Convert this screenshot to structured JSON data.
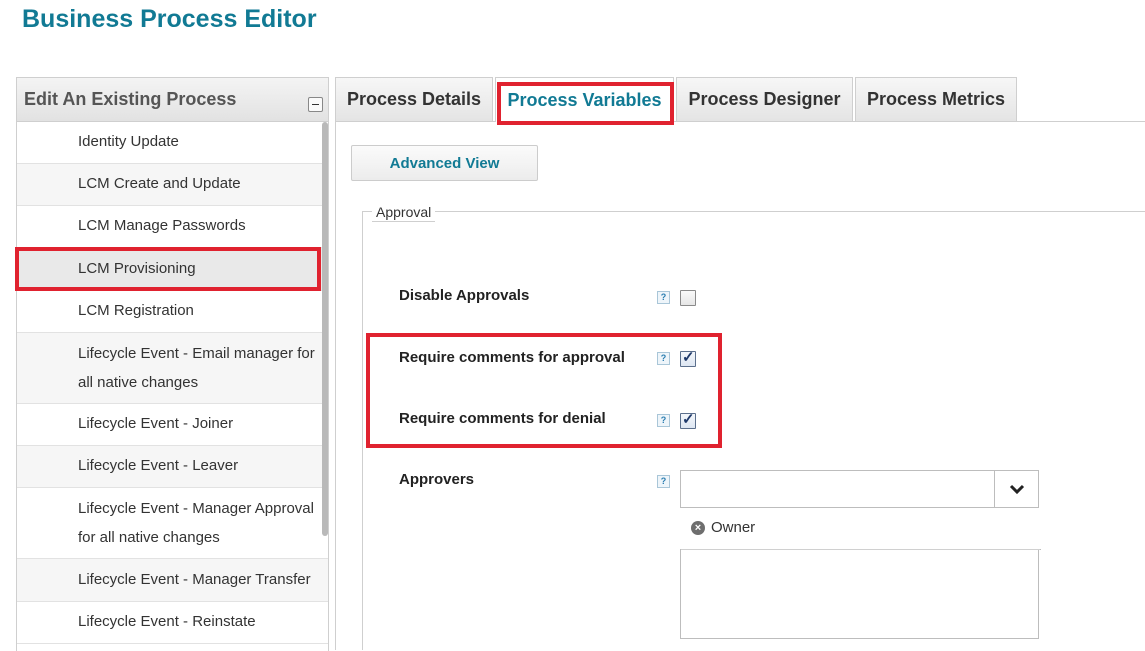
{
  "app": {
    "title": "Business Process Editor"
  },
  "sidebar": {
    "title": "Edit An Existing Process",
    "items": [
      {
        "label": "Identity Update"
      },
      {
        "label": "LCM Create and Update"
      },
      {
        "label": "LCM Manage Passwords"
      },
      {
        "label": "LCM Provisioning",
        "selected": true
      },
      {
        "label": "LCM Registration"
      },
      {
        "label": "Lifecycle Event - Email manager for all native changes"
      },
      {
        "label": "Lifecycle Event - Joiner"
      },
      {
        "label": "Lifecycle Event - Leaver"
      },
      {
        "label": "Lifecycle Event - Manager Approval for all native changes"
      },
      {
        "label": "Lifecycle Event - Manager Transfer"
      },
      {
        "label": "Lifecycle Event - Reinstate"
      }
    ]
  },
  "tabs": [
    {
      "label": "Process Details"
    },
    {
      "label": "Process Variables",
      "active": true
    },
    {
      "label": "Process Designer"
    },
    {
      "label": "Process Metrics"
    }
  ],
  "main": {
    "advanced_view_label": "Advanced View",
    "section_legend": "Approval",
    "fields": {
      "disable_approvals": {
        "label": "Disable Approvals",
        "checked": false
      },
      "require_comments_approval": {
        "label": "Require comments for approval",
        "checked": true
      },
      "require_comments_denial": {
        "label": "Require comments for denial",
        "checked": true
      },
      "approvers": {
        "label": "Approvers",
        "value": "",
        "selected": [
          "Owner"
        ]
      }
    },
    "help_glyph": "?",
    "check_glyph": "✓",
    "remove_glyph": "×"
  },
  "colors": {
    "brand": "#117a94",
    "highlight": "#e0222f"
  }
}
